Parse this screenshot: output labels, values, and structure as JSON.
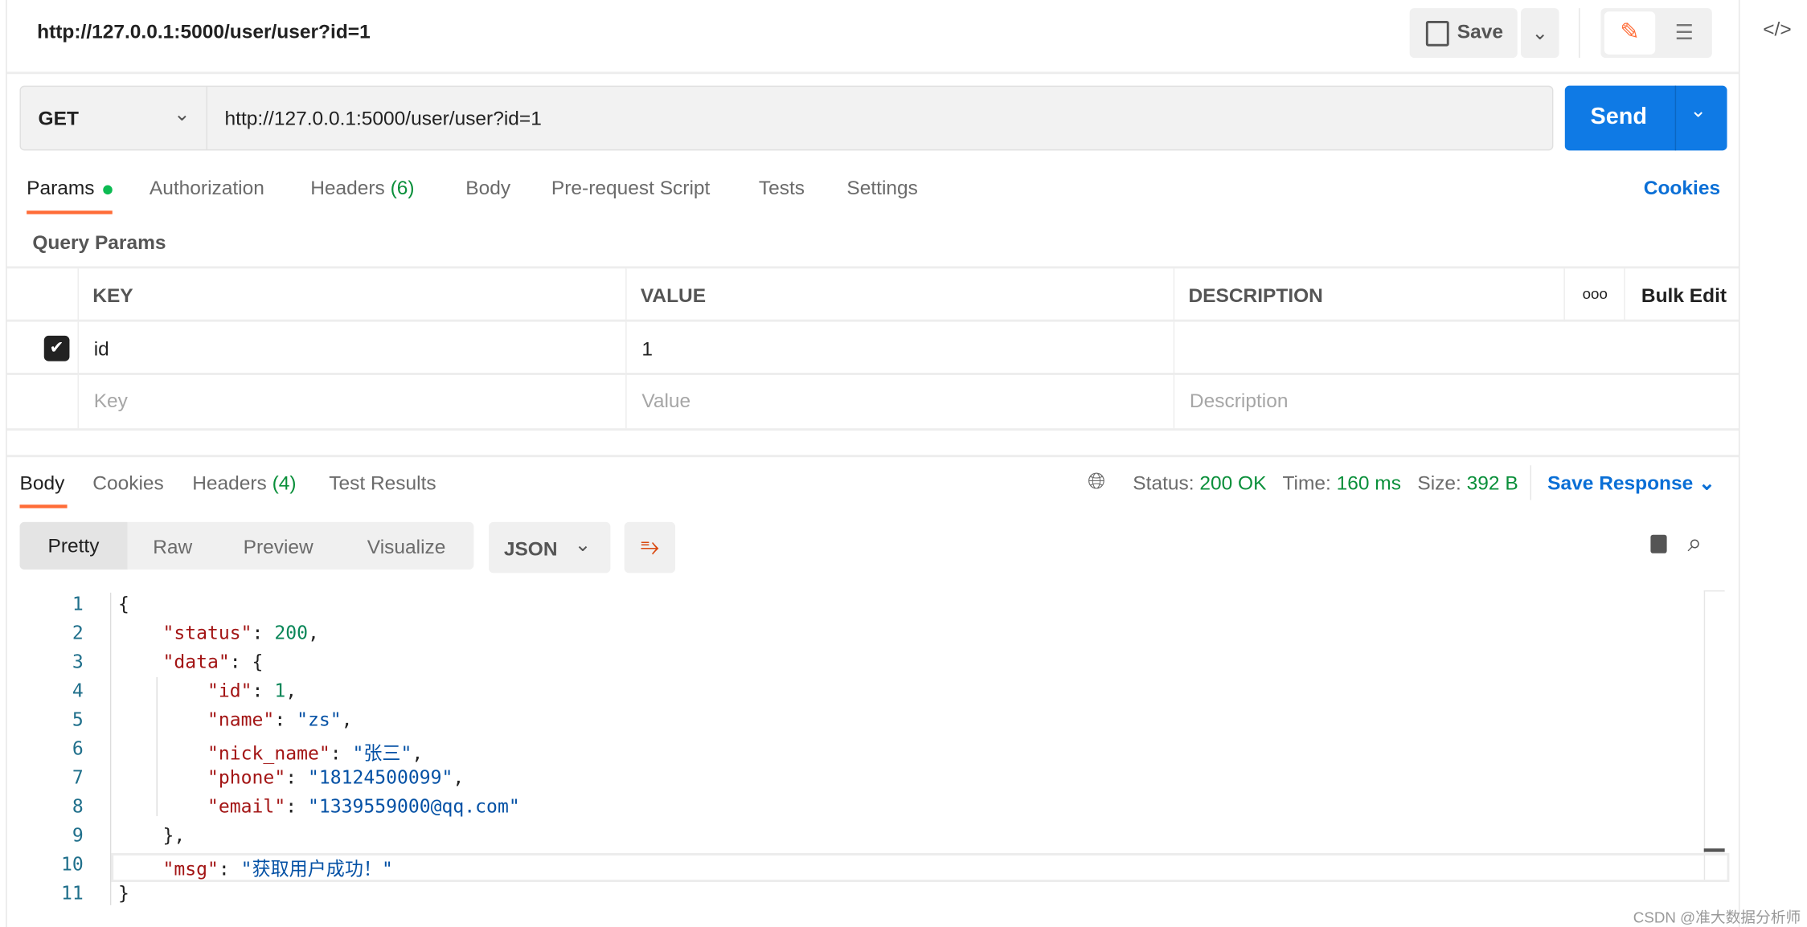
{
  "header": {
    "title": "http://127.0.0.1:5000/user/user?id=1",
    "save_label": "Save"
  },
  "request": {
    "method": "GET",
    "url": "http://127.0.0.1:5000/user/user?id=1",
    "send_label": "Send"
  },
  "request_tabs": [
    {
      "label": "Params",
      "active": true
    },
    {
      "label": "Authorization"
    },
    {
      "label": "Headers",
      "count": "(6)"
    },
    {
      "label": "Body"
    },
    {
      "label": "Pre-request Script"
    },
    {
      "label": "Tests"
    },
    {
      "label": "Settings"
    }
  ],
  "cookies_link": "Cookies",
  "query_params": {
    "title": "Query Params",
    "headers": [
      "KEY",
      "VALUE",
      "DESCRIPTION"
    ],
    "bulk_edit": "Bulk Edit",
    "rows": [
      {
        "checked": true,
        "key": "id",
        "value": "1",
        "description": ""
      }
    ],
    "placeholders": {
      "key": "Key",
      "value": "Value",
      "description": "Description"
    }
  },
  "response": {
    "tabs": [
      {
        "label": "Body",
        "active": true
      },
      {
        "label": "Cookies"
      },
      {
        "label": "Headers",
        "count": "(4)"
      },
      {
        "label": "Test Results"
      }
    ],
    "status_label": "Status:",
    "status": "200 OK",
    "time_label": "Time:",
    "time": "160 ms",
    "size_label": "Size:",
    "size": "392 B",
    "save_response": "Save Response",
    "view_modes": [
      "Pretty",
      "Raw",
      "Preview",
      "Visualize"
    ],
    "active_view": "Pretty",
    "format": "JSON",
    "lines": [
      [
        [
          "p",
          "{"
        ]
      ],
      [
        [
          "p",
          "    "
        ],
        [
          "k",
          "\"status\""
        ],
        [
          "p",
          ": "
        ],
        [
          "n",
          "200"
        ],
        [
          "p",
          ","
        ]
      ],
      [
        [
          "p",
          "    "
        ],
        [
          "k",
          "\"data\""
        ],
        [
          "p",
          ": {"
        ]
      ],
      [
        [
          "p",
          "        "
        ],
        [
          "k",
          "\"id\""
        ],
        [
          "p",
          ": "
        ],
        [
          "n",
          "1"
        ],
        [
          "p",
          ","
        ]
      ],
      [
        [
          "p",
          "        "
        ],
        [
          "k",
          "\"name\""
        ],
        [
          "p",
          ": "
        ],
        [
          "s",
          "\"zs\""
        ],
        [
          "p",
          ","
        ]
      ],
      [
        [
          "p",
          "        "
        ],
        [
          "k",
          "\"nick_name\""
        ],
        [
          "p",
          ": "
        ],
        [
          "s",
          "\"张三\""
        ],
        [
          "p",
          ","
        ]
      ],
      [
        [
          "p",
          "        "
        ],
        [
          "k",
          "\"phone\""
        ],
        [
          "p",
          ": "
        ],
        [
          "s",
          "\"18124500099\""
        ],
        [
          "p",
          ","
        ]
      ],
      [
        [
          "p",
          "        "
        ],
        [
          "k",
          "\"email\""
        ],
        [
          "p",
          ": "
        ],
        [
          "s",
          "\"1339559000@qq.com\""
        ]
      ],
      [
        [
          "p",
          "    },"
        ]
      ],
      [
        [
          "p",
          "    "
        ],
        [
          "k",
          "\"msg\""
        ],
        [
          "p",
          ": "
        ],
        [
          "s",
          "\"获取用户成功！\""
        ]
      ],
      [
        [
          "p",
          "}"
        ]
      ]
    ]
  },
  "watermark": "CSDN @准大数据分析师",
  "colors": {
    "accent": "#ff6c37",
    "send": "#0f7ae5",
    "green": "#0a8f3a",
    "link": "#0a6fd6"
  }
}
